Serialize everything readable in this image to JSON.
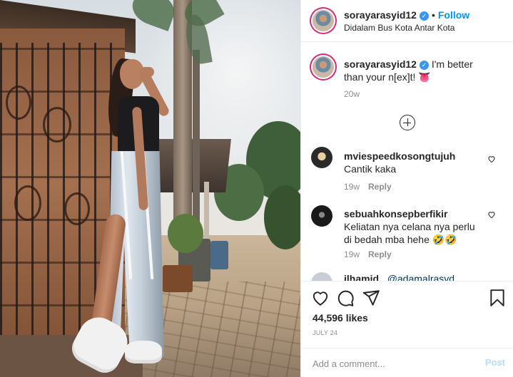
{
  "post": {
    "author": {
      "username": "sorayarasyid12",
      "verified": true,
      "follow_label": "Follow",
      "location": "Didalam Bus Kota Antar Kota"
    },
    "caption": {
      "username": "sorayarasyid12",
      "text": "I'm better than your n[ex]t! 👅",
      "age": "20w"
    },
    "comments": [
      {
        "username": "mviespeedkosongtujuh",
        "text": "Cantik kaka",
        "age": "19w",
        "reply_label": "Reply"
      },
      {
        "username": "sebuahkonsepberfikir",
        "text": "Keliatan nya celana nya perlu di bedah mba hehe 🤣🤣",
        "age": "19w",
        "reply_label": "Reply"
      },
      {
        "username": "ilhamid_",
        "text": "@adamalrasyd",
        "age": "",
        "reply_label": ""
      }
    ],
    "likes": "44,596 likes",
    "date": "JULY 24",
    "add_comment_placeholder": "Add a comment...",
    "post_label": "Post"
  },
  "icons": {
    "like": "heart-icon",
    "comment": "comment-icon",
    "share": "share-icon",
    "save": "bookmark-icon",
    "load_more": "plus-circle-icon"
  },
  "colors": {
    "follow": "#0095f6",
    "verified": "#3897f0",
    "post_disabled": "#b2dffc",
    "meta": "#8e8e8e"
  }
}
